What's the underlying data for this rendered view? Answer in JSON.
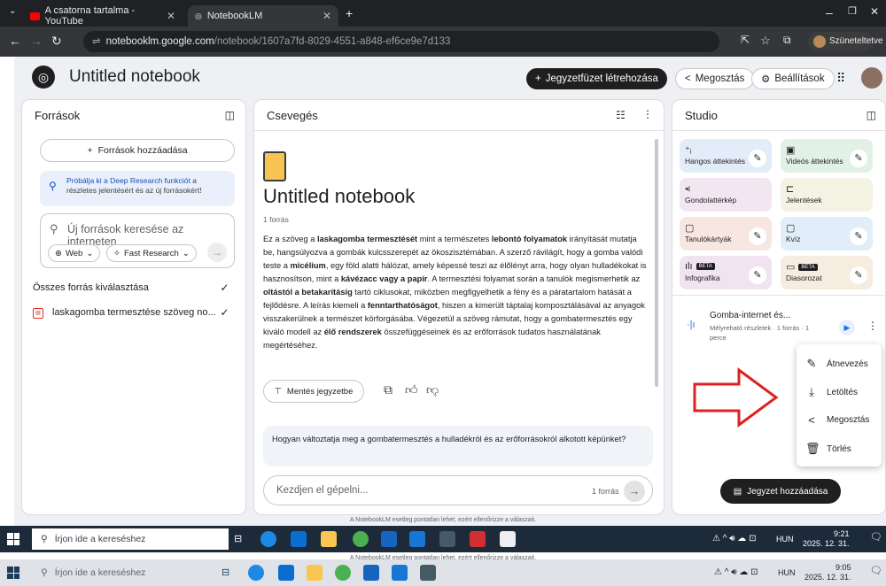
{
  "browser": {
    "tabs": [
      {
        "title": "A csatorna tartalma - YouTube"
      },
      {
        "title": "NotebookLM"
      }
    ],
    "url_host": "notebooklm.google.com",
    "url_path": "/notebook/1607a7fd-8029-4551-a848-ef6ce9e7d133",
    "profile_label": "Szüneteltetve"
  },
  "header": {
    "title": "Untitled notebook",
    "create_label": "Jegyzetfüzet létrehozása",
    "share_label": "Megosztás",
    "settings_label": "Beállítások"
  },
  "sources": {
    "title": "Források",
    "add_label": "Források hozzáadása",
    "deep_research_link": "Próbálja ki a Deep Research funkciót",
    "deep_research_rest": " a részletes jelentésért és az új forrásokért!",
    "search_placeholder": "Új források keresése az interneten",
    "web_chip": "Web",
    "fast_chip": "Fast Research",
    "select_all": "Összes forrás kiválasztása",
    "items": [
      {
        "name": "laskagomba termesztése szöveg no..."
      }
    ]
  },
  "chat": {
    "title": "Csevegés",
    "notebook_title": "Untitled notebook",
    "source_count": "1 forrás",
    "summary_segments": [
      {
        "t": "Ez a szöveg a ",
        "b": false
      },
      {
        "t": "laskagomba termesztését",
        "b": true
      },
      {
        "t": " mint a természetes ",
        "b": false
      },
      {
        "t": "lebontó folyamatok",
        "b": true
      },
      {
        "t": " irányítását mutatja be, hangsúlyozva a gombák kulcsszerepét az ökoszisztémában. A szerző rávilágít, hogy a gomba valódi teste a ",
        "b": false
      },
      {
        "t": "micélium",
        "b": true
      },
      {
        "t": ", egy föld alatti hálózat, amely képessé teszi az élőlényt arra, hogy olyan hulladékokat is hasznosítson, mint a ",
        "b": false
      },
      {
        "t": "kávézacc vagy a papír",
        "b": true
      },
      {
        "t": ". A termesztési folyamat során a tanulók megismerhetik az ",
        "b": false
      },
      {
        "t": "oltástól a betakarításig",
        "b": true
      },
      {
        "t": " tartó ciklusokat, miközben megfigyelhetik a fény és a páratartalom hatását a fejlődésre. A leírás kiemeli a ",
        "b": false
      },
      {
        "t": "fenntarthatóságot",
        "b": true
      },
      {
        "t": ", hiszen a kimerült táptalaj komposztálásával az anyagok visszakerülnek a természet körforgásába. Végezetül a szöveg rámutat, hogy a gombatermesztés egy kiváló modell az ",
        "b": false
      },
      {
        "t": "élő rendszerek",
        "b": true
      },
      {
        "t": " összefüggéseinek és az erőforrások tudatos használatának megértéséhez.",
        "b": false
      }
    ],
    "save_label": "Mentés jegyzetbe",
    "question": "Hogyan változtatja meg a gombatermesztés a hulladékról és az erőforrásokról alkotott képünket?",
    "input_placeholder": "Kezdjen el gépelni...",
    "input_source_count": "1 forrás"
  },
  "studio": {
    "title": "Studio",
    "cards": [
      {
        "label": "Hangos áttekintés",
        "bg": "#e3ecf9",
        "icon": "⁺ᵢ",
        "pen": true,
        "beta": false
      },
      {
        "label": "Videós áttekintés",
        "bg": "#e1f1e6",
        "icon": "▣",
        "pen": true,
        "beta": false
      },
      {
        "label": "Gondolattérkép",
        "bg": "#f2e6f1",
        "icon": "⪪",
        "pen": false,
        "beta": false
      },
      {
        "label": "Jelentések",
        "bg": "#f3f2e3",
        "icon": "⊏",
        "pen": false,
        "beta": false
      },
      {
        "label": "Tanulókártyák",
        "bg": "#f8e6e3",
        "icon": "▢",
        "pen": true,
        "beta": false
      },
      {
        "label": "Kvíz",
        "bg": "#e1eef9",
        "icon": "▢",
        "pen": true,
        "beta": false
      },
      {
        "label": "Infografika",
        "bg": "#f1e3ef",
        "icon": "ılı",
        "pen": true,
        "beta": true
      },
      {
        "label": "Diasorozat",
        "bg": "#f6ece0",
        "icon": "▭",
        "pen": true,
        "beta": true
      }
    ],
    "beta_label": "BÉTA",
    "generated": {
      "title": "Gomba-internet és...",
      "meta": "Mélyreható részletek · 1 forrás · 1 perce"
    },
    "menu": [
      {
        "label": "Átnevezés",
        "icon": "pencil-icon"
      },
      {
        "label": "Letöltés",
        "icon": "download-icon"
      },
      {
        "label": "Megosztás",
        "icon": "share-icon"
      },
      {
        "label": "Törlés",
        "icon": "trash-icon"
      }
    ],
    "add_note_label": "Jegyzet hozzáadása"
  },
  "disclaimer": "A NotebookLM esetleg pontatlan lehet, ezért ellenőrizze a válaszait.",
  "taskbar": {
    "search_placeholder": "Írjon ide a kereséshez",
    "lang": "HUN",
    "time_front": "9:21",
    "date_front": "2025. 12. 31.",
    "time_back": "9:05",
    "date_back": "2025. 12. 31."
  }
}
